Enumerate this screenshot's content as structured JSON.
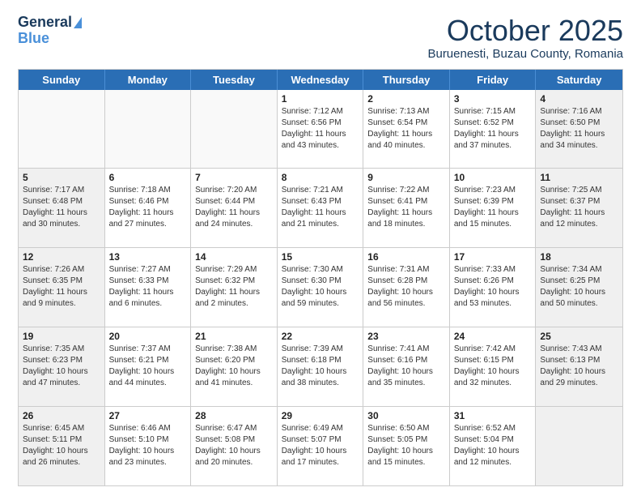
{
  "logo": {
    "line1": "General",
    "line2": "Blue"
  },
  "title": "October 2025",
  "subtitle": "Buruenesti, Buzau County, Romania",
  "days": [
    "Sunday",
    "Monday",
    "Tuesday",
    "Wednesday",
    "Thursday",
    "Friday",
    "Saturday"
  ],
  "rows": [
    [
      {
        "day": "",
        "text": "",
        "empty": true
      },
      {
        "day": "",
        "text": "",
        "empty": true
      },
      {
        "day": "",
        "text": "",
        "empty": true
      },
      {
        "day": "1",
        "text": "Sunrise: 7:12 AM\nSunset: 6:56 PM\nDaylight: 11 hours and 43 minutes.",
        "empty": false
      },
      {
        "day": "2",
        "text": "Sunrise: 7:13 AM\nSunset: 6:54 PM\nDaylight: 11 hours and 40 minutes.",
        "empty": false
      },
      {
        "day": "3",
        "text": "Sunrise: 7:15 AM\nSunset: 6:52 PM\nDaylight: 11 hours and 37 minutes.",
        "empty": false
      },
      {
        "day": "4",
        "text": "Sunrise: 7:16 AM\nSunset: 6:50 PM\nDaylight: 11 hours and 34 minutes.",
        "empty": false,
        "shaded": true
      }
    ],
    [
      {
        "day": "5",
        "text": "Sunrise: 7:17 AM\nSunset: 6:48 PM\nDaylight: 11 hours and 30 minutes.",
        "empty": false,
        "shaded": true
      },
      {
        "day": "6",
        "text": "Sunrise: 7:18 AM\nSunset: 6:46 PM\nDaylight: 11 hours and 27 minutes.",
        "empty": false
      },
      {
        "day": "7",
        "text": "Sunrise: 7:20 AM\nSunset: 6:44 PM\nDaylight: 11 hours and 24 minutes.",
        "empty": false
      },
      {
        "day": "8",
        "text": "Sunrise: 7:21 AM\nSunset: 6:43 PM\nDaylight: 11 hours and 21 minutes.",
        "empty": false
      },
      {
        "day": "9",
        "text": "Sunrise: 7:22 AM\nSunset: 6:41 PM\nDaylight: 11 hours and 18 minutes.",
        "empty": false
      },
      {
        "day": "10",
        "text": "Sunrise: 7:23 AM\nSunset: 6:39 PM\nDaylight: 11 hours and 15 minutes.",
        "empty": false
      },
      {
        "day": "11",
        "text": "Sunrise: 7:25 AM\nSunset: 6:37 PM\nDaylight: 11 hours and 12 minutes.",
        "empty": false,
        "shaded": true
      }
    ],
    [
      {
        "day": "12",
        "text": "Sunrise: 7:26 AM\nSunset: 6:35 PM\nDaylight: 11 hours and 9 minutes.",
        "empty": false,
        "shaded": true
      },
      {
        "day": "13",
        "text": "Sunrise: 7:27 AM\nSunset: 6:33 PM\nDaylight: 11 hours and 6 minutes.",
        "empty": false
      },
      {
        "day": "14",
        "text": "Sunrise: 7:29 AM\nSunset: 6:32 PM\nDaylight: 11 hours and 2 minutes.",
        "empty": false
      },
      {
        "day": "15",
        "text": "Sunrise: 7:30 AM\nSunset: 6:30 PM\nDaylight: 10 hours and 59 minutes.",
        "empty": false
      },
      {
        "day": "16",
        "text": "Sunrise: 7:31 AM\nSunset: 6:28 PM\nDaylight: 10 hours and 56 minutes.",
        "empty": false
      },
      {
        "day": "17",
        "text": "Sunrise: 7:33 AM\nSunset: 6:26 PM\nDaylight: 10 hours and 53 minutes.",
        "empty": false
      },
      {
        "day": "18",
        "text": "Sunrise: 7:34 AM\nSunset: 6:25 PM\nDaylight: 10 hours and 50 minutes.",
        "empty": false,
        "shaded": true
      }
    ],
    [
      {
        "day": "19",
        "text": "Sunrise: 7:35 AM\nSunset: 6:23 PM\nDaylight: 10 hours and 47 minutes.",
        "empty": false,
        "shaded": true
      },
      {
        "day": "20",
        "text": "Sunrise: 7:37 AM\nSunset: 6:21 PM\nDaylight: 10 hours and 44 minutes.",
        "empty": false
      },
      {
        "day": "21",
        "text": "Sunrise: 7:38 AM\nSunset: 6:20 PM\nDaylight: 10 hours and 41 minutes.",
        "empty": false
      },
      {
        "day": "22",
        "text": "Sunrise: 7:39 AM\nSunset: 6:18 PM\nDaylight: 10 hours and 38 minutes.",
        "empty": false
      },
      {
        "day": "23",
        "text": "Sunrise: 7:41 AM\nSunset: 6:16 PM\nDaylight: 10 hours and 35 minutes.",
        "empty": false
      },
      {
        "day": "24",
        "text": "Sunrise: 7:42 AM\nSunset: 6:15 PM\nDaylight: 10 hours and 32 minutes.",
        "empty": false
      },
      {
        "day": "25",
        "text": "Sunrise: 7:43 AM\nSunset: 6:13 PM\nDaylight: 10 hours and 29 minutes.",
        "empty": false,
        "shaded": true
      }
    ],
    [
      {
        "day": "26",
        "text": "Sunrise: 6:45 AM\nSunset: 5:11 PM\nDaylight: 10 hours and 26 minutes.",
        "empty": false,
        "shaded": true
      },
      {
        "day": "27",
        "text": "Sunrise: 6:46 AM\nSunset: 5:10 PM\nDaylight: 10 hours and 23 minutes.",
        "empty": false
      },
      {
        "day": "28",
        "text": "Sunrise: 6:47 AM\nSunset: 5:08 PM\nDaylight: 10 hours and 20 minutes.",
        "empty": false
      },
      {
        "day": "29",
        "text": "Sunrise: 6:49 AM\nSunset: 5:07 PM\nDaylight: 10 hours and 17 minutes.",
        "empty": false
      },
      {
        "day": "30",
        "text": "Sunrise: 6:50 AM\nSunset: 5:05 PM\nDaylight: 10 hours and 15 minutes.",
        "empty": false
      },
      {
        "day": "31",
        "text": "Sunrise: 6:52 AM\nSunset: 5:04 PM\nDaylight: 10 hours and 12 minutes.",
        "empty": false
      },
      {
        "day": "",
        "text": "",
        "empty": true,
        "shaded": true
      }
    ]
  ]
}
